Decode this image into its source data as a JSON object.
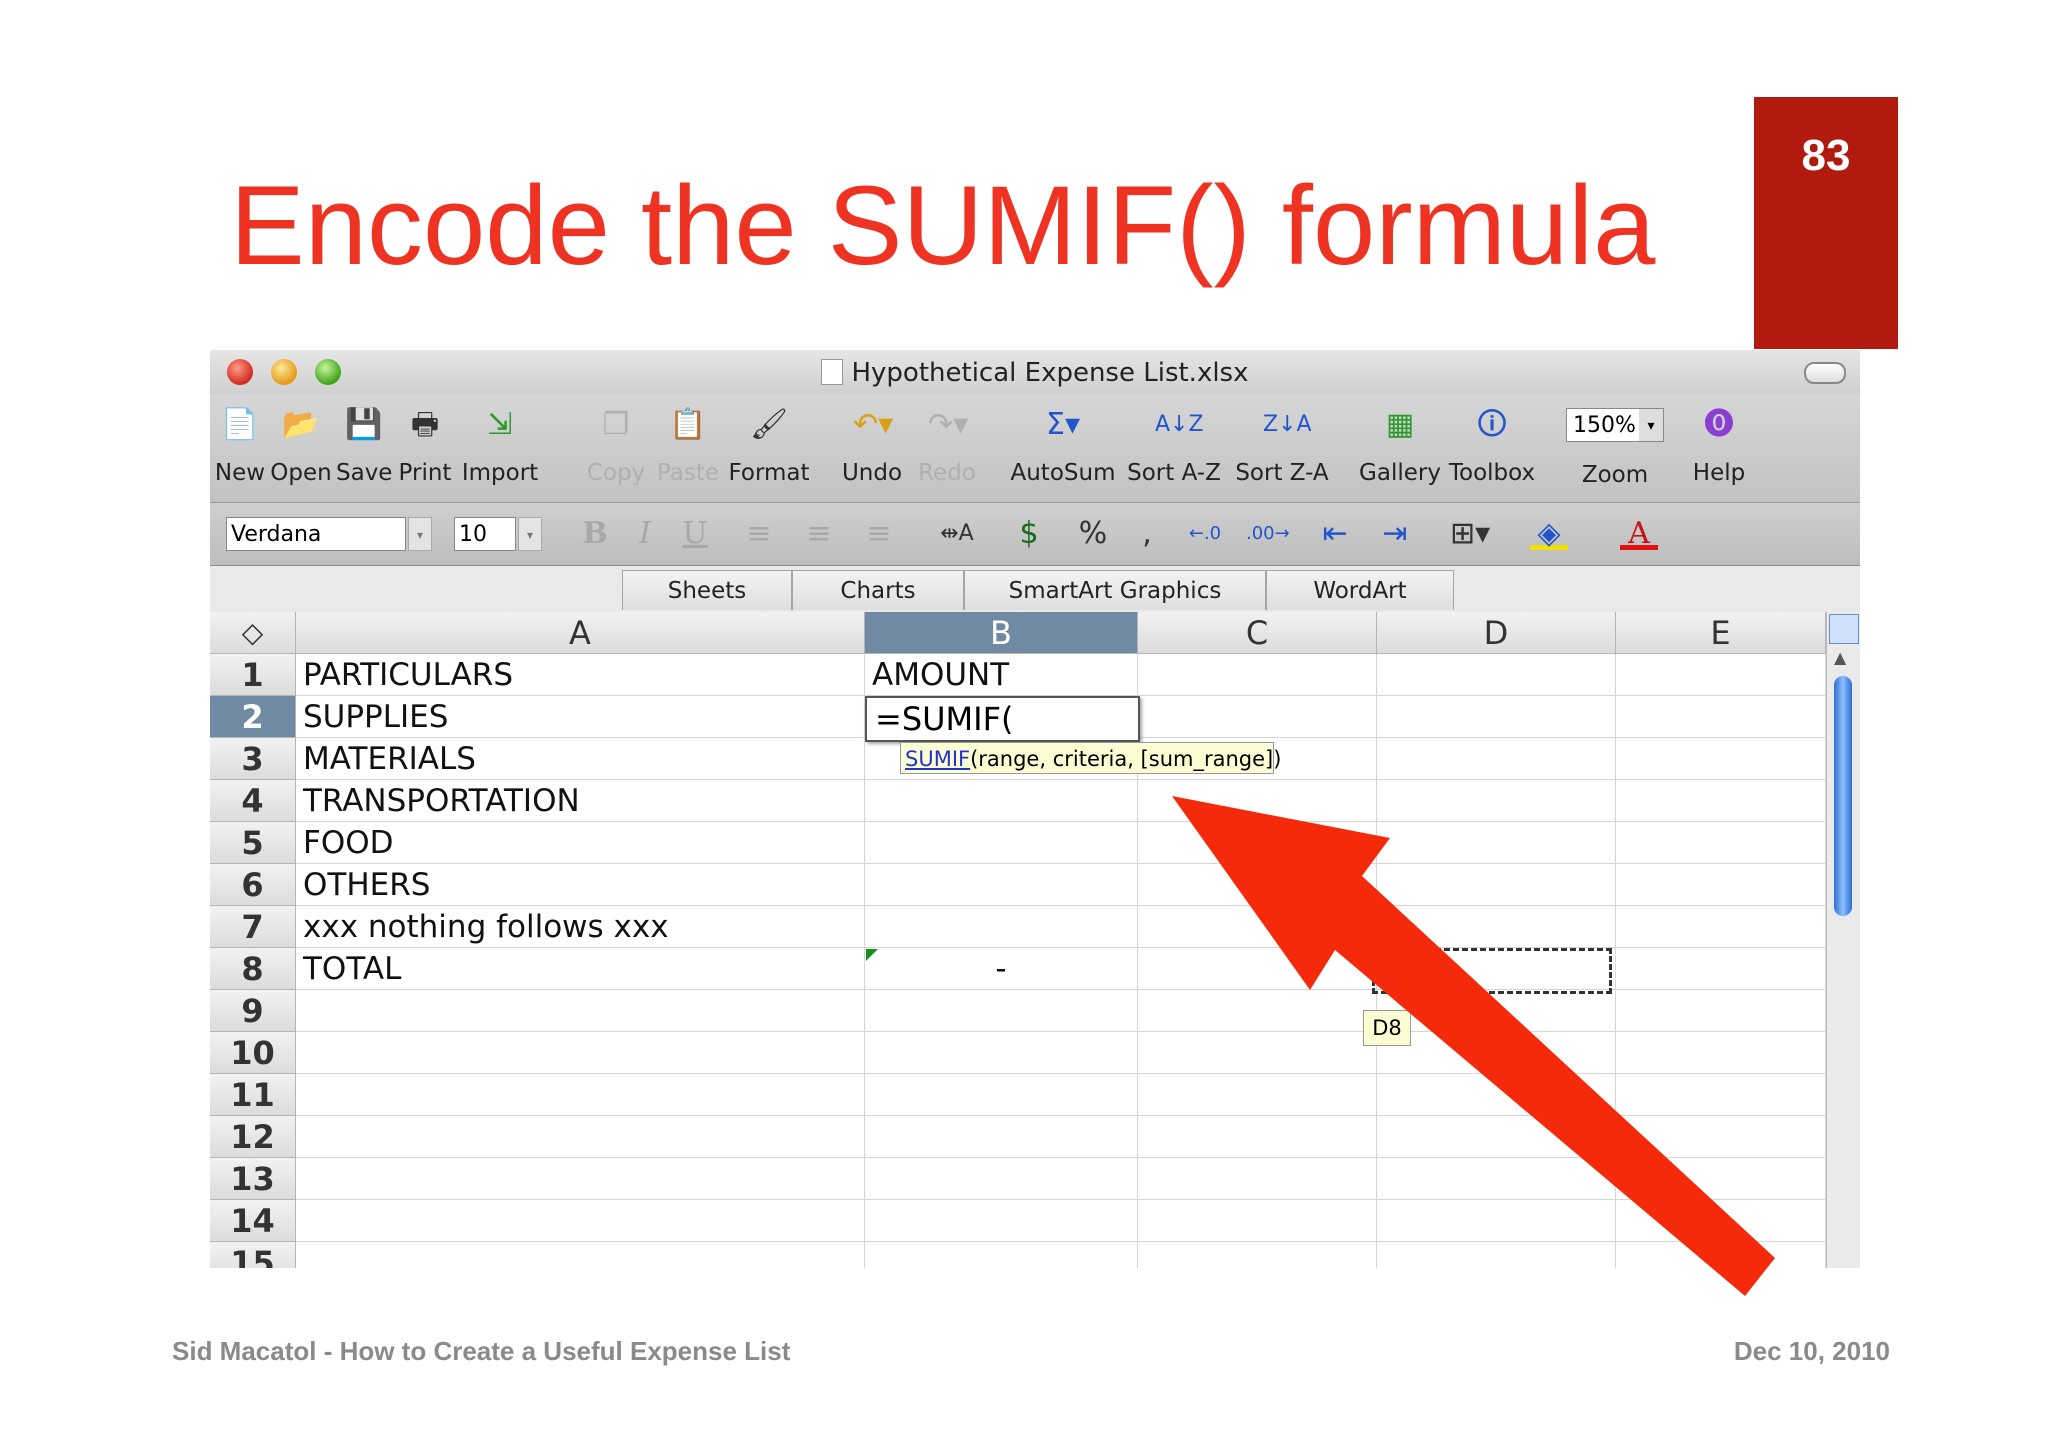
{
  "slide": {
    "title": "Encode the SUMIF() formula",
    "page_number": "83",
    "footer_left": "Sid Macatol - How to Create a Useful Expense List",
    "footer_right": "Dec 10, 2010",
    "accent_color": "#ee3322",
    "badge_color": "#b01a0f"
  },
  "window": {
    "title": "Hypothetical Expense List.xlsx"
  },
  "toolbar": {
    "buttons": [
      {
        "label": "New",
        "icon": "new-icon"
      },
      {
        "label": "Open",
        "icon": "open-icon"
      },
      {
        "label": "Save",
        "icon": "save-icon"
      },
      {
        "label": "Print",
        "icon": "print-icon"
      },
      {
        "label": "Import",
        "icon": "import-icon"
      },
      {
        "label": "Copy",
        "icon": "copy-icon"
      },
      {
        "label": "Paste",
        "icon": "paste-icon"
      },
      {
        "label": "Format",
        "icon": "format-brush-icon"
      },
      {
        "label": "Undo",
        "icon": "undo-icon"
      },
      {
        "label": "Redo",
        "icon": "redo-icon"
      },
      {
        "label": "AutoSum",
        "icon": "sigma-icon"
      },
      {
        "label": "Sort A-Z",
        "icon": "sort-az-icon"
      },
      {
        "label": "Sort Z-A",
        "icon": "sort-za-icon"
      },
      {
        "label": "Gallery",
        "icon": "gallery-icon"
      },
      {
        "label": "Toolbox",
        "icon": "toolbox-icon"
      },
      {
        "label": "Zoom",
        "icon": "zoom-select"
      },
      {
        "label": "Help",
        "icon": "help-icon"
      }
    ],
    "zoom_value": "150%"
  },
  "formatbar": {
    "font": "Verdana",
    "size": "10"
  },
  "ribbon_tabs": [
    "Sheets",
    "Charts",
    "SmartArt Graphics",
    "WordArt"
  ],
  "sheet": {
    "columns": [
      "A",
      "B",
      "C",
      "D",
      "E"
    ],
    "rows": [
      "1",
      "2",
      "3",
      "4",
      "5",
      "6",
      "7",
      "8",
      "9",
      "10",
      "11",
      "12",
      "13",
      "14",
      "15"
    ],
    "col_a": [
      "PARTICULARS",
      "SUPPLIES",
      "MATERIALS",
      "TRANSPORTATION",
      "FOOD",
      "OTHERS",
      "xxx nothing follows xxx",
      "TOTAL"
    ],
    "b1": "AMOUNT",
    "b8": "-",
    "editing_value": "=SUMIF(",
    "tooltip_fn": "SUMIF",
    "tooltip_args": "(range, criteria, [sum_range])",
    "cell_ref_tip": "D8"
  },
  "arrow_color": "#f52a0a"
}
